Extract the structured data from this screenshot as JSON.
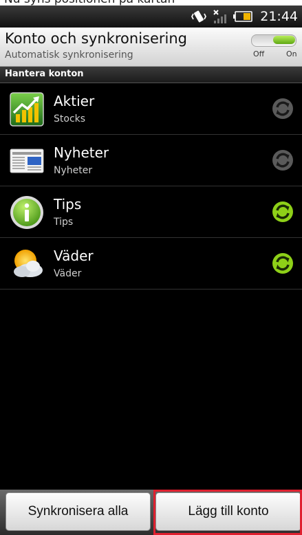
{
  "top_text": "Nu syns positionen på kartan",
  "status_bar": {
    "time": "21:44"
  },
  "header": {
    "title": "Konto och synkronisering",
    "subtitle": "Automatisk synkronisering",
    "toggle": {
      "off_label": "Off",
      "on_label": "On",
      "state": "on"
    }
  },
  "section": {
    "label": "Hantera konton"
  },
  "accounts": [
    {
      "name": "Aktier",
      "description": "Stocks",
      "icon": "stocks-icon",
      "sync_active": false
    },
    {
      "name": "Nyheter",
      "description": "Nyheter",
      "icon": "news-icon",
      "sync_active": false
    },
    {
      "name": "Tips",
      "description": "Tips",
      "icon": "info-icon",
      "sync_active": true
    },
    {
      "name": "Väder",
      "description": "Väder",
      "icon": "weather-icon",
      "sync_active": true
    }
  ],
  "footer": {
    "sync_all_label": "Synkronisera alla",
    "add_account_label": "Lägg till konto"
  },
  "colors": {
    "sync_active": "#8ed018",
    "sync_inactive": "#5a5a5a",
    "toggle_on": "#6fb81c",
    "highlight": "#e0202f"
  }
}
